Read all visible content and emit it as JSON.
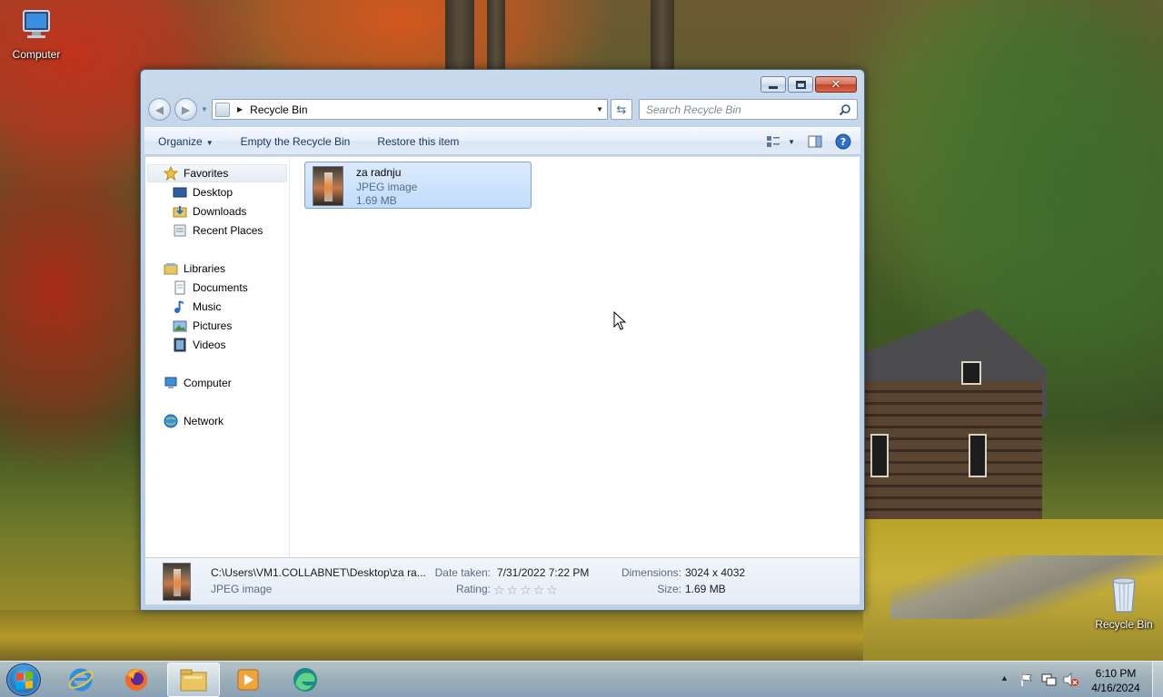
{
  "desktop": {
    "icons": [
      {
        "label": "Computer"
      },
      {
        "label": "Recycle Bin"
      }
    ]
  },
  "window": {
    "address": {
      "location": "Recycle Bin"
    },
    "search": {
      "placeholder": "Search Recycle Bin"
    },
    "toolbar": {
      "organize": "Organize",
      "empty": "Empty the Recycle Bin",
      "restore": "Restore this item"
    },
    "nav": {
      "favorites": "Favorites",
      "desktop": "Desktop",
      "downloads": "Downloads",
      "recent": "Recent Places",
      "libraries": "Libraries",
      "documents": "Documents",
      "music": "Music",
      "pictures": "Pictures",
      "videos": "Videos",
      "computer": "Computer",
      "network": "Network"
    },
    "file": {
      "name": "za radnju",
      "type": "JPEG image",
      "size": "1.69 MB"
    },
    "details": {
      "path": "C:\\Users\\VM1.COLLABNET\\Desktop\\za ra...",
      "type": "JPEG image",
      "date_label": "Date taken:",
      "date_value": "7/31/2022 7:22 PM",
      "rating_label": "Rating:",
      "rating_value": 0,
      "dimensions_label": "Dimensions:",
      "dimensions_value": "3024 x 4032",
      "size_label": "Size:",
      "size_value": "1.69 MB"
    }
  },
  "taskbar": {
    "apps": [
      "start-button",
      "internet-explorer",
      "firefox",
      "windows-explorer",
      "media-player",
      "edge"
    ],
    "active_app": "windows-explorer",
    "clock": {
      "time": "6:10 PM",
      "date": "4/16/2024"
    }
  }
}
